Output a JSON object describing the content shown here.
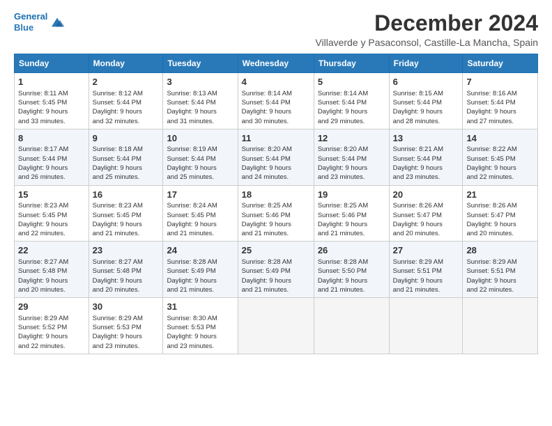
{
  "header": {
    "logo_line1": "General",
    "logo_line2": "Blue",
    "title": "December 2024",
    "subtitle": "Villaverde y Pasaconsol, Castille-La Mancha, Spain"
  },
  "columns": [
    "Sunday",
    "Monday",
    "Tuesday",
    "Wednesday",
    "Thursday",
    "Friday",
    "Saturday"
  ],
  "weeks": [
    [
      {
        "day": "1",
        "info": "Sunrise: 8:11 AM\nSunset: 5:45 PM\nDaylight: 9 hours\nand 33 minutes."
      },
      {
        "day": "2",
        "info": "Sunrise: 8:12 AM\nSunset: 5:44 PM\nDaylight: 9 hours\nand 32 minutes."
      },
      {
        "day": "3",
        "info": "Sunrise: 8:13 AM\nSunset: 5:44 PM\nDaylight: 9 hours\nand 31 minutes."
      },
      {
        "day": "4",
        "info": "Sunrise: 8:14 AM\nSunset: 5:44 PM\nDaylight: 9 hours\nand 30 minutes."
      },
      {
        "day": "5",
        "info": "Sunrise: 8:14 AM\nSunset: 5:44 PM\nDaylight: 9 hours\nand 29 minutes."
      },
      {
        "day": "6",
        "info": "Sunrise: 8:15 AM\nSunset: 5:44 PM\nDaylight: 9 hours\nand 28 minutes."
      },
      {
        "day": "7",
        "info": "Sunrise: 8:16 AM\nSunset: 5:44 PM\nDaylight: 9 hours\nand 27 minutes."
      }
    ],
    [
      {
        "day": "8",
        "info": "Sunrise: 8:17 AM\nSunset: 5:44 PM\nDaylight: 9 hours\nand 26 minutes."
      },
      {
        "day": "9",
        "info": "Sunrise: 8:18 AM\nSunset: 5:44 PM\nDaylight: 9 hours\nand 25 minutes."
      },
      {
        "day": "10",
        "info": "Sunrise: 8:19 AM\nSunset: 5:44 PM\nDaylight: 9 hours\nand 25 minutes."
      },
      {
        "day": "11",
        "info": "Sunrise: 8:20 AM\nSunset: 5:44 PM\nDaylight: 9 hours\nand 24 minutes."
      },
      {
        "day": "12",
        "info": "Sunrise: 8:20 AM\nSunset: 5:44 PM\nDaylight: 9 hours\nand 23 minutes."
      },
      {
        "day": "13",
        "info": "Sunrise: 8:21 AM\nSunset: 5:44 PM\nDaylight: 9 hours\nand 23 minutes."
      },
      {
        "day": "14",
        "info": "Sunrise: 8:22 AM\nSunset: 5:45 PM\nDaylight: 9 hours\nand 22 minutes."
      }
    ],
    [
      {
        "day": "15",
        "info": "Sunrise: 8:23 AM\nSunset: 5:45 PM\nDaylight: 9 hours\nand 22 minutes."
      },
      {
        "day": "16",
        "info": "Sunrise: 8:23 AM\nSunset: 5:45 PM\nDaylight: 9 hours\nand 21 minutes."
      },
      {
        "day": "17",
        "info": "Sunrise: 8:24 AM\nSunset: 5:45 PM\nDaylight: 9 hours\nand 21 minutes."
      },
      {
        "day": "18",
        "info": "Sunrise: 8:25 AM\nSunset: 5:46 PM\nDaylight: 9 hours\nand 21 minutes."
      },
      {
        "day": "19",
        "info": "Sunrise: 8:25 AM\nSunset: 5:46 PM\nDaylight: 9 hours\nand 21 minutes."
      },
      {
        "day": "20",
        "info": "Sunrise: 8:26 AM\nSunset: 5:47 PM\nDaylight: 9 hours\nand 20 minutes."
      },
      {
        "day": "21",
        "info": "Sunrise: 8:26 AM\nSunset: 5:47 PM\nDaylight: 9 hours\nand 20 minutes."
      }
    ],
    [
      {
        "day": "22",
        "info": "Sunrise: 8:27 AM\nSunset: 5:48 PM\nDaylight: 9 hours\nand 20 minutes."
      },
      {
        "day": "23",
        "info": "Sunrise: 8:27 AM\nSunset: 5:48 PM\nDaylight: 9 hours\nand 20 minutes."
      },
      {
        "day": "24",
        "info": "Sunrise: 8:28 AM\nSunset: 5:49 PM\nDaylight: 9 hours\nand 21 minutes."
      },
      {
        "day": "25",
        "info": "Sunrise: 8:28 AM\nSunset: 5:49 PM\nDaylight: 9 hours\nand 21 minutes."
      },
      {
        "day": "26",
        "info": "Sunrise: 8:28 AM\nSunset: 5:50 PM\nDaylight: 9 hours\nand 21 minutes."
      },
      {
        "day": "27",
        "info": "Sunrise: 8:29 AM\nSunset: 5:51 PM\nDaylight: 9 hours\nand 21 minutes."
      },
      {
        "day": "28",
        "info": "Sunrise: 8:29 AM\nSunset: 5:51 PM\nDaylight: 9 hours\nand 22 minutes."
      }
    ],
    [
      {
        "day": "29",
        "info": "Sunrise: 8:29 AM\nSunset: 5:52 PM\nDaylight: 9 hours\nand 22 minutes."
      },
      {
        "day": "30",
        "info": "Sunrise: 8:29 AM\nSunset: 5:53 PM\nDaylight: 9 hours\nand 23 minutes."
      },
      {
        "day": "31",
        "info": "Sunrise: 8:30 AM\nSunset: 5:53 PM\nDaylight: 9 hours\nand 23 minutes."
      },
      null,
      null,
      null,
      null
    ]
  ]
}
